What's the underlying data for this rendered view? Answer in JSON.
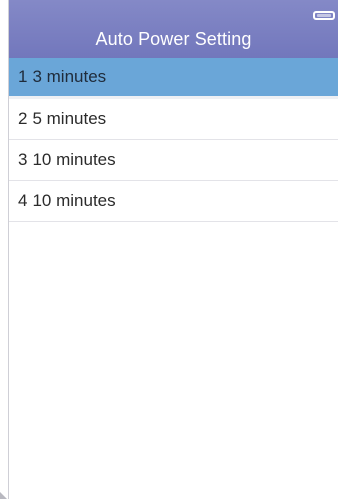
{
  "header": {
    "title": "Auto Power Setting",
    "battery_icon": "battery-icon"
  },
  "options": [
    {
      "number": "1",
      "label": "3 minutes",
      "selected": true
    },
    {
      "number": "2",
      "label": "5 minutes",
      "selected": false
    },
    {
      "number": "3",
      "label": "10 minutes",
      "selected": false
    },
    {
      "number": "4",
      "label": "10 minutes",
      "selected": false
    }
  ],
  "colors": {
    "titlebar": "#7a7fc2",
    "selected_row": "#6aa6d8",
    "text": "#2b2b2b"
  }
}
